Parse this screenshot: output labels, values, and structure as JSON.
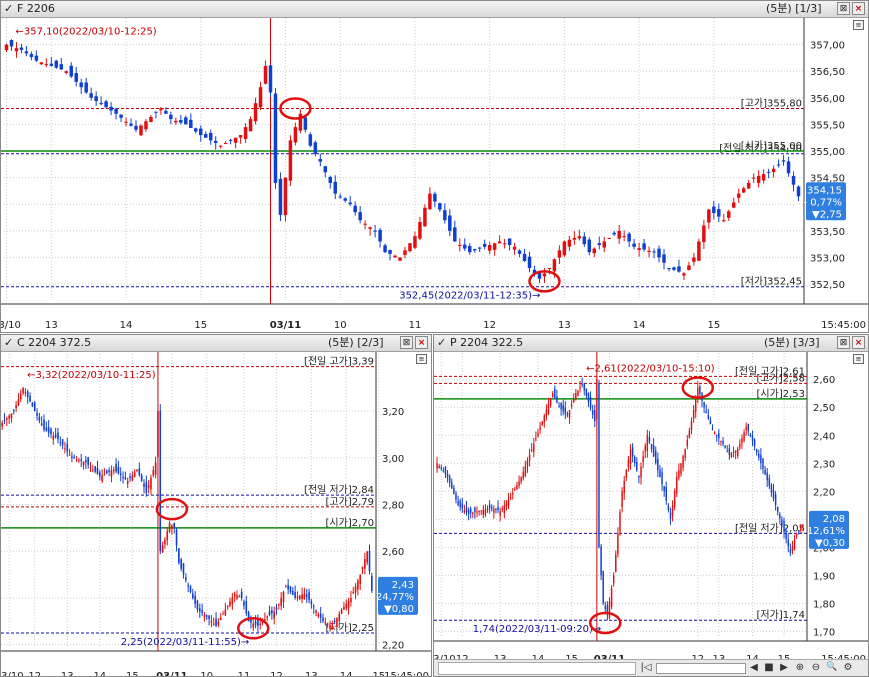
{
  "panels": [
    {
      "id": "F",
      "checked_icon": "check-icon",
      "title": "F 2206",
      "info": "(5분) [1/3]",
      "time_label": "15:45:00",
      "chart_data": {
        "type": "candlestick",
        "ylim": [
          352.2,
          357.35
        ],
        "y_ticks": [
          "357,00",
          "356,50",
          "356,00",
          "355,50",
          "355,00",
          "354,50",
          "354,00",
          "353,50",
          "353,00",
          "352,50"
        ],
        "y_tick_values": [
          357.0,
          356.5,
          356.0,
          355.5,
          355.0,
          354.5,
          354.0,
          353.5,
          353.0,
          352.5
        ],
        "x_labels": [
          "03/10",
          "13",
          "14",
          "15",
          "03/11",
          "10",
          "11",
          "12",
          "13",
          "14",
          "15"
        ],
        "x_label_bars": [
          0,
          9,
          24,
          39,
          56,
          67,
          82,
          97,
          112,
          127,
          142
        ],
        "day_break_bar": 53.5,
        "n_bars": 160,
        "bullets": [
          {
            "value": 355.8,
            "label": "[고가]355,80",
            "color": "#c00000",
            "style": "dash"
          },
          {
            "value": 354.95,
            "label": "[전일 저가]354,90",
            "color": "#1010a0",
            "style": "dash"
          },
          {
            "value": 355.0,
            "label": "[시가]355,00",
            "color": "#0a8a0a",
            "style": "solid"
          },
          {
            "value": 352.45,
            "label": "[저가]352,45",
            "color": "#1010a0",
            "style": "dash"
          }
        ],
        "high_note": {
          "bar": 1,
          "value": 357.1,
          "text": "357,10(2022/03/10-12:25)"
        },
        "low_note": {
          "bar": 108,
          "value": 352.45,
          "text": "352,45(2022/03/11-12:35)"
        },
        "circles": [
          {
            "bar": 58,
            "value": 355.8
          },
          {
            "bar": 108,
            "value": 352.55
          }
        ],
        "current": {
          "price": "354,15",
          "change": "- 0,77%",
          "diff": "▼2,75",
          "value": 354.15
        },
        "anchors": [
          [
            0,
            357.0
          ],
          [
            3,
            356.9
          ],
          [
            6,
            356.7
          ],
          [
            12,
            356.5
          ],
          [
            17,
            356.0
          ],
          [
            22,
            355.7
          ],
          [
            26,
            355.4
          ],
          [
            31,
            355.8
          ],
          [
            33,
            355.6
          ],
          [
            36,
            355.5
          ],
          [
            39,
            355.3
          ],
          [
            43,
            355.1
          ],
          [
            47,
            355.3
          ],
          [
            49,
            355.6
          ],
          [
            51,
            356.2
          ],
          [
            52,
            356.6
          ],
          [
            53,
            356.1
          ],
          [
            54,
            354.4
          ],
          [
            55,
            353.8
          ],
          [
            57,
            355.2
          ],
          [
            59,
            355.7
          ],
          [
            61,
            355.1
          ],
          [
            63,
            354.8
          ],
          [
            66,
            354.2
          ],
          [
            69,
            354.0
          ],
          [
            71,
            353.7
          ],
          [
            74,
            353.5
          ],
          [
            76,
            353.1
          ],
          [
            79,
            353.0
          ],
          [
            82,
            353.4
          ],
          [
            85,
            354.2
          ],
          [
            87,
            353.9
          ],
          [
            90,
            353.3
          ],
          [
            93,
            353.1
          ],
          [
            96,
            353.2
          ],
          [
            99,
            353.3
          ],
          [
            102,
            353.2
          ],
          [
            105,
            352.8
          ],
          [
            107,
            352.6
          ],
          [
            109,
            352.8
          ],
          [
            112,
            353.3
          ],
          [
            115,
            353.4
          ],
          [
            117,
            353.1
          ],
          [
            120,
            353.3
          ],
          [
            123,
            353.5
          ],
          [
            126,
            353.2
          ],
          [
            130,
            353.1
          ],
          [
            133,
            352.8
          ],
          [
            136,
            352.7
          ],
          [
            138,
            353.0
          ],
          [
            141,
            353.9
          ],
          [
            144,
            353.7
          ],
          [
            147,
            354.2
          ],
          [
            150,
            354.5
          ],
          [
            153,
            354.6
          ],
          [
            156,
            354.8
          ],
          [
            159,
            354.15
          ]
        ]
      }
    },
    {
      "id": "C",
      "checked_icon": "check-icon",
      "title": "C 2204 372.5",
      "info": "(5분) [2/3]",
      "time_label": "15:45:00",
      "chart_data": {
        "type": "candlestick",
        "ylim": [
          2.19,
          3.41
        ],
        "y_ticks": [
          "3,20",
          "3,00",
          "2,80",
          "2,60",
          "2,40",
          "2,20"
        ],
        "y_tick_values": [
          3.2,
          3.0,
          2.8,
          2.6,
          2.4,
          2.2
        ],
        "x_labels": [
          "03/10",
          "12",
          "13",
          "14",
          "15",
          "03/11",
          "10",
          "11",
          "12",
          "13",
          "14",
          "15"
        ],
        "x_label_bars": [
          3,
          14,
          28,
          42,
          56,
          73,
          88,
          104,
          118,
          133,
          148,
          162
        ],
        "day_break_bar": 67.5,
        "n_bars": 160,
        "bullets": [
          {
            "value": 3.39,
            "label": "[전일 고가]3,39",
            "color": "#c00000",
            "style": "dash"
          },
          {
            "value": 2.84,
            "label": "[전일 저가]2,84",
            "color": "#1010a0",
            "style": "dash"
          },
          {
            "value": 2.79,
            "label": "[고가]2,79",
            "color": "#c00000",
            "style": "dash"
          },
          {
            "value": 2.7,
            "label": "[시가]2,70",
            "color": "#0a8a0a",
            "style": "solid"
          },
          {
            "value": 2.25,
            "label": "[저가]2,25",
            "color": "#1010a0",
            "style": "dash"
          }
        ],
        "high_note": {
          "bar": 9,
          "value": 3.32,
          "text": "3,32(2022/03/10-11:25)"
        },
        "low_note": {
          "bar": 108,
          "value": 2.25,
          "text": "2,25(2022/03/11-11:55)"
        },
        "circles": [
          {
            "bar": 73,
            "value": 2.78
          },
          {
            "bar": 108,
            "value": 2.27
          }
        ],
        "current": {
          "price": "2,43",
          "change": "- 24,77%",
          "diff": "▼0,80",
          "value": 2.43
        },
        "anchors": [
          [
            0,
            3.15
          ],
          [
            5,
            3.2
          ],
          [
            9,
            3.3
          ],
          [
            13,
            3.22
          ],
          [
            18,
            3.12
          ],
          [
            24,
            3.08
          ],
          [
            30,
            3.0
          ],
          [
            36,
            2.98
          ],
          [
            42,
            2.92
          ],
          [
            48,
            2.95
          ],
          [
            54,
            2.9
          ],
          [
            58,
            2.95
          ],
          [
            62,
            2.85
          ],
          [
            66,
            2.98
          ],
          [
            67,
            3.2
          ],
          [
            68,
            2.6
          ],
          [
            70,
            2.65
          ],
          [
            72,
            2.72
          ],
          [
            74,
            2.7
          ],
          [
            76,
            2.55
          ],
          [
            80,
            2.45
          ],
          [
            84,
            2.35
          ],
          [
            88,
            2.32
          ],
          [
            92,
            2.28
          ],
          [
            96,
            2.35
          ],
          [
            100,
            2.42
          ],
          [
            103,
            2.4
          ],
          [
            106,
            2.3
          ],
          [
            110,
            2.28
          ],
          [
            114,
            2.32
          ],
          [
            118,
            2.35
          ],
          [
            122,
            2.45
          ],
          [
            126,
            2.4
          ],
          [
            130,
            2.42
          ],
          [
            134,
            2.36
          ],
          [
            138,
            2.3
          ],
          [
            142,
            2.28
          ],
          [
            146,
            2.35
          ],
          [
            150,
            2.4
          ],
          [
            154,
            2.5
          ],
          [
            157,
            2.6
          ],
          [
            159,
            2.43
          ]
        ]
      }
    },
    {
      "id": "P",
      "checked_icon": "check-icon",
      "title": "P 2204 322.5",
      "info": "(5분) [3/3]",
      "time_label": "15:45:00",
      "chart_data": {
        "type": "candlestick",
        "ylim": [
          1.68,
          2.665
        ],
        "y_ticks": [
          "2,60",
          "2,50",
          "2,40",
          "2,30",
          "2,20",
          "2,10",
          "2,00",
          "1,90",
          "1,80",
          "1,70"
        ],
        "y_tick_values": [
          2.6,
          2.5,
          2.4,
          2.3,
          2.2,
          2.1,
          2.0,
          1.9,
          1.8,
          1.7
        ],
        "x_labels": [
          "03/10",
          "12",
          "13",
          "14",
          "15",
          "03/11",
          "12",
          "13",
          "14",
          "15"
        ],
        "x_label_bars": [
          2,
          12,
          30,
          48,
          64,
          82,
          124,
          134,
          150,
          165
        ],
        "day_break_bar": 76.5,
        "n_bars": 175,
        "bullets": [
          {
            "value": 2.61,
            "label": "[전일 고가]2,61",
            "color": "#c00000",
            "style": "dash"
          },
          {
            "value": 2.585,
            "label": "[고가]2,58",
            "color": "#c00000",
            "style": "dash"
          },
          {
            "value": 2.53,
            "label": "[시가]2,53",
            "color": "#0a8a0a",
            "style": "solid"
          },
          {
            "value": 2.05,
            "label": "[전일 저가]2,05",
            "color": "#1010a0",
            "style": "dash"
          },
          {
            "value": 1.74,
            "label": "[저가]1,74",
            "color": "#1010a0",
            "style": "dash"
          }
        ],
        "high_note": {
          "bar": 69,
          "value": 2.61,
          "text": "2,61(2022/03/10-15:10)"
        },
        "low_note": {
          "bar": 80,
          "value": 1.74,
          "text": "1,74(2022/03/11-09:20)"
        },
        "circles": [
          {
            "bar": 124,
            "value": 2.57
          },
          {
            "bar": 80,
            "value": 1.73
          }
        ],
        "current": {
          "price": "2,08",
          "change": "- 12,61%",
          "diff": "▼0,30",
          "value": 2.08
        },
        "anchors": [
          [
            0,
            2.3
          ],
          [
            5,
            2.25
          ],
          [
            10,
            2.15
          ],
          [
            15,
            2.12
          ],
          [
            20,
            2.13
          ],
          [
            25,
            2.14
          ],
          [
            30,
            2.13
          ],
          [
            35,
            2.18
          ],
          [
            40,
            2.25
          ],
          [
            45,
            2.35
          ],
          [
            50,
            2.45
          ],
          [
            55,
            2.55
          ],
          [
            58,
            2.5
          ],
          [
            62,
            2.47
          ],
          [
            66,
            2.55
          ],
          [
            69,
            2.58
          ],
          [
            72,
            2.52
          ],
          [
            75,
            2.45
          ],
          [
            76,
            2.6
          ],
          [
            77,
            2.0
          ],
          [
            79,
            1.8
          ],
          [
            81,
            1.76
          ],
          [
            84,
            1.9
          ],
          [
            88,
            2.2
          ],
          [
            92,
            2.35
          ],
          [
            96,
            2.25
          ],
          [
            100,
            2.4
          ],
          [
            104,
            2.3
          ],
          [
            108,
            2.2
          ],
          [
            111,
            2.1
          ],
          [
            114,
            2.25
          ],
          [
            118,
            2.35
          ],
          [
            121,
            2.45
          ],
          [
            124,
            2.57
          ],
          [
            127,
            2.5
          ],
          [
            131,
            2.42
          ],
          [
            135,
            2.38
          ],
          [
            139,
            2.33
          ],
          [
            143,
            2.35
          ],
          [
            147,
            2.43
          ],
          [
            150,
            2.38
          ],
          [
            154,
            2.3
          ],
          [
            158,
            2.22
          ],
          [
            161,
            2.15
          ],
          [
            164,
            2.08
          ],
          [
            168,
            1.98
          ],
          [
            171,
            2.05
          ],
          [
            174,
            2.08
          ]
        ]
      }
    }
  ],
  "nav": {
    "btn_first": "|◁",
    "btn_prev": "◀",
    "btn_stop": "■",
    "btn_next": "▶",
    "btn_zoom_in": "⊕",
    "btn_zoom_out": "⊖",
    "btn_search": "🔍",
    "btn_settings": "⚙"
  }
}
